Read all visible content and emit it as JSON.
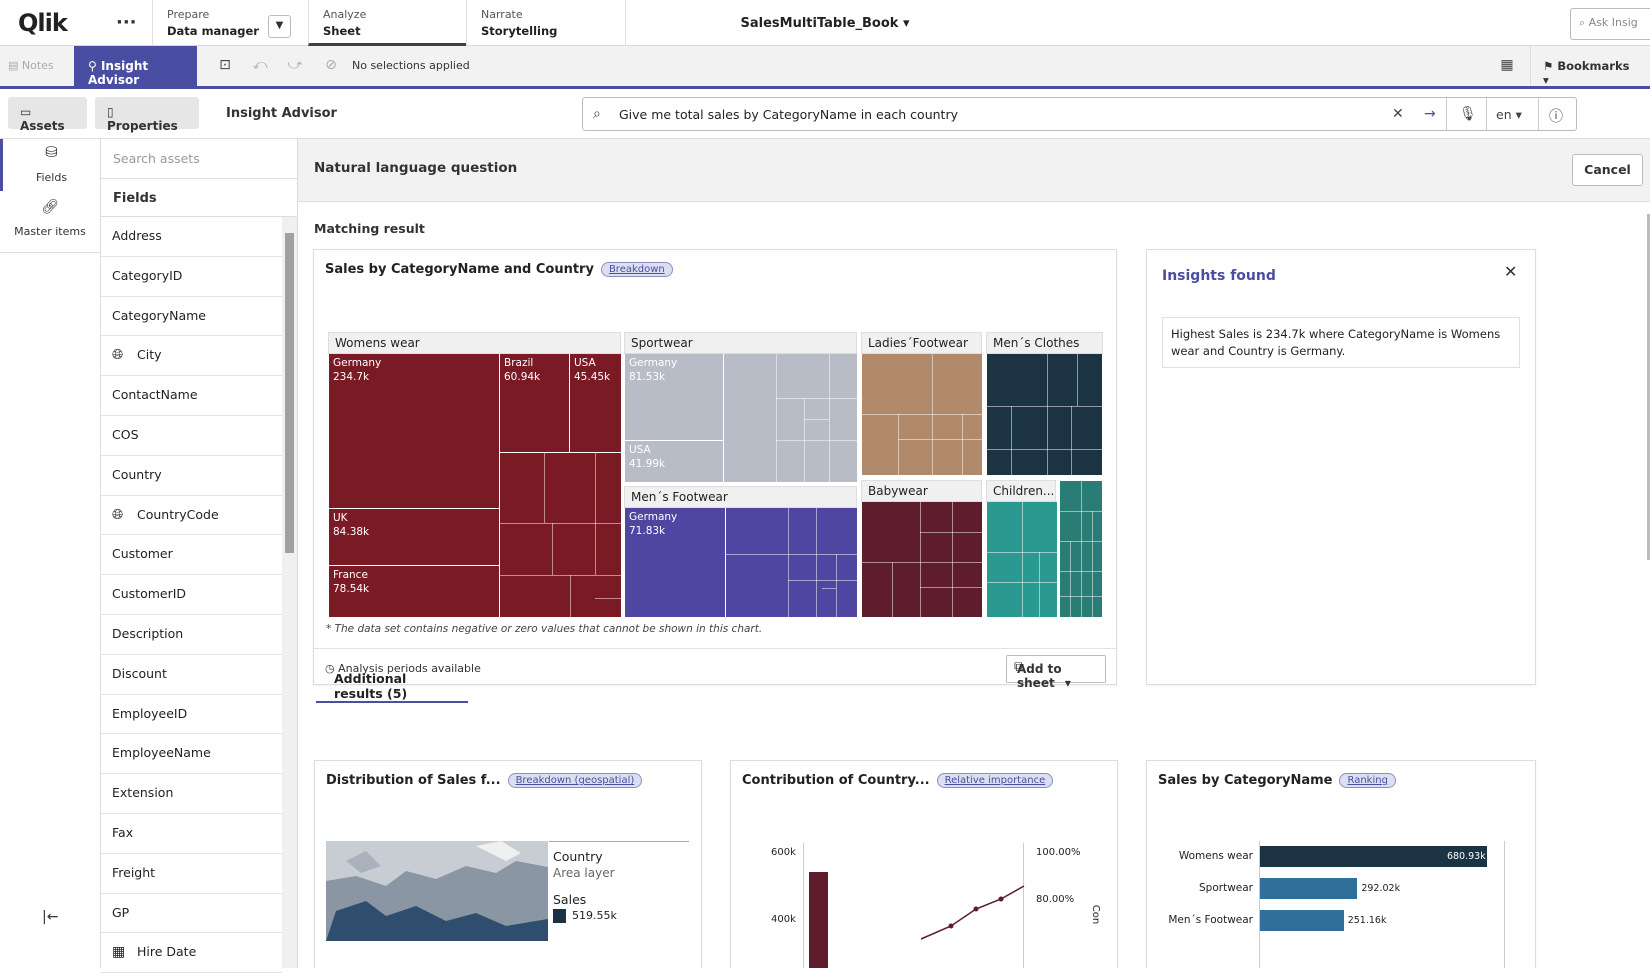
{
  "topbar": {
    "logo": "Qlik",
    "more": "···",
    "tabs": [
      {
        "top": "Prepare",
        "bottom": "Data manager"
      },
      {
        "top": "Analyze",
        "bottom": "Sheet"
      },
      {
        "top": "Narrate",
        "bottom": "Storytelling"
      }
    ],
    "app_title": "SalesMultiTable_Book",
    "ask_placeholder": "Ask Insig"
  },
  "toolbar": {
    "notes": "Notes",
    "insight_advisor": "Insight Advisor",
    "no_selections": "No selections applied",
    "bookmarks": "Bookmarks"
  },
  "subbar": {
    "assets": "Assets",
    "properties": "Properties",
    "title": "Insight Advisor",
    "question": "Give me total sales by CategoryName  in each country",
    "language": "en"
  },
  "rail": {
    "fields": "Fields",
    "master_items": "Master items"
  },
  "fields_panel": {
    "search_placeholder": "Search assets",
    "header": "Fields",
    "items": [
      {
        "label": "Address",
        "geo": false
      },
      {
        "label": "CategoryID",
        "geo": false
      },
      {
        "label": "CategoryName",
        "geo": false
      },
      {
        "label": "City",
        "geo": true
      },
      {
        "label": "ContactName",
        "geo": false
      },
      {
        "label": "COS",
        "geo": false
      },
      {
        "label": "Country",
        "geo": false
      },
      {
        "label": "CountryCode",
        "geo": true
      },
      {
        "label": "Customer",
        "geo": false
      },
      {
        "label": "CustomerID",
        "geo": false
      },
      {
        "label": "Description",
        "geo": false
      },
      {
        "label": "Discount",
        "geo": false
      },
      {
        "label": "EmployeeID",
        "geo": false
      },
      {
        "label": "EmployeeName",
        "geo": false
      },
      {
        "label": "Extension",
        "geo": false
      },
      {
        "label": "Fax",
        "geo": false
      },
      {
        "label": "Freight",
        "geo": false
      },
      {
        "label": "GP",
        "geo": false
      },
      {
        "label": "Hire Date",
        "geo": false,
        "date": true
      }
    ]
  },
  "main": {
    "header": "Natural language question",
    "cancel": "Cancel",
    "matching_result": "Matching result",
    "result_card": {
      "title": "Sales by CategoryName and Country",
      "badge": "Breakdown",
      "note": "* The data set contains negative or zero values that cannot be shown in this chart.",
      "footer": "Analysis periods available",
      "add_to_sheet": "Add to sheet"
    },
    "insights": {
      "title": "Insights found",
      "text": "Highest Sales is 234.7k where CategoryName is Womens wear and Country is Germany."
    },
    "additional_tab": "Additional results (5)",
    "additional_cards": [
      {
        "title": "Distribution of Sales f...",
        "badge": "Breakdown (geospatial)",
        "legend_title": "Country",
        "legend_sub": "Area layer",
        "legend_measure": "Sales",
        "legend_value": "519.55k"
      },
      {
        "title": "Contribution of Country...",
        "badge": "Relative importance",
        "y_ticks": [
          "600k",
          "400k"
        ],
        "y2_ticks": [
          "100.00%",
          "80.00%"
        ],
        "y2_label": "Con"
      },
      {
        "title": "Sales by CategoryName",
        "badge": "Ranking"
      }
    ]
  },
  "chart_data": [
    {
      "type": "treemap",
      "title": "Sales by CategoryName and Country",
      "groups": [
        {
          "name": "Womens wear",
          "color": "#7a1a24",
          "cells": [
            {
              "label": "Germany",
              "value": "234.7k"
            },
            {
              "label": "Brazil",
              "value": "60.94k"
            },
            {
              "label": "USA",
              "value": "45.45k"
            },
            {
              "label": "UK",
              "value": "84.38k"
            },
            {
              "label": "France",
              "value": "78.54k"
            }
          ]
        },
        {
          "name": "Sportwear",
          "color": "#b8bcc6",
          "cells": [
            {
              "label": "Germany",
              "value": "81.53k"
            },
            {
              "label": "USA",
              "value": "41.99k"
            }
          ]
        },
        {
          "name": "Men´s Footwear",
          "color": "#4e46a0",
          "cells": [
            {
              "label": "Germany",
              "value": "71.83k"
            }
          ]
        },
        {
          "name": "Ladies´Footwear",
          "color": "#b08a6a",
          "cells": []
        },
        {
          "name": "Men´s Clothes",
          "color": "#1c3344",
          "cells": []
        },
        {
          "name": "Babywear",
          "color": "#5e1c2c",
          "cells": []
        },
        {
          "name": "Children...",
          "color": "#2a9a90",
          "cells": []
        }
      ]
    },
    {
      "type": "bar",
      "title": "Sales by CategoryName",
      "categories": [
        "Womens wear",
        "Sportwear",
        "Men´s Footwear"
      ],
      "values": [
        680.93,
        292.02,
        251.16
      ],
      "value_labels": [
        "680.93k",
        "292.02k",
        "251.16k"
      ],
      "unit": "k"
    }
  ]
}
